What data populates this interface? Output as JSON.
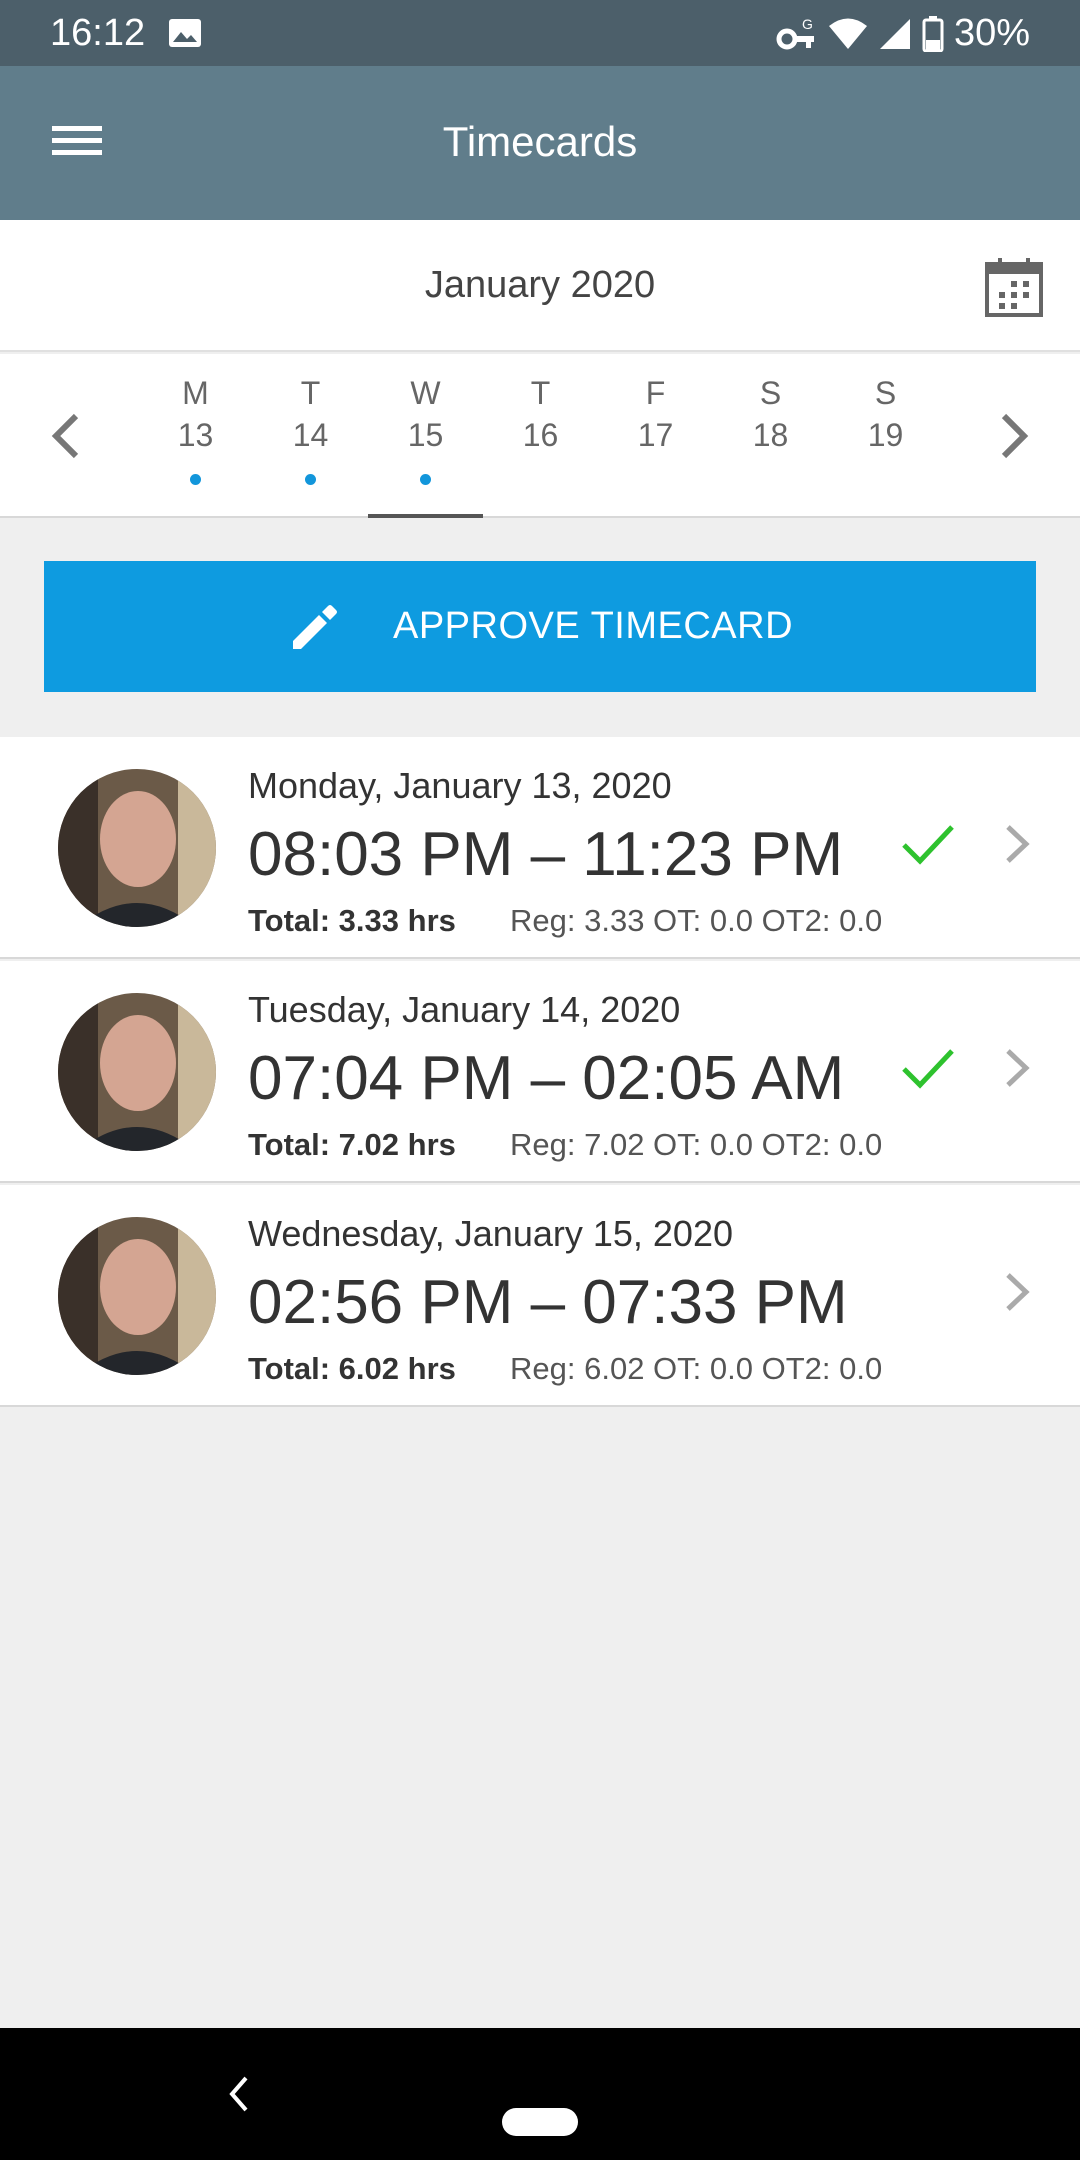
{
  "status_bar": {
    "time": "16:12",
    "battery": "30%"
  },
  "app_bar": {
    "title": "Timecards"
  },
  "month": {
    "label": "January 2020"
  },
  "week": {
    "days": [
      {
        "letter": "M",
        "num": "13",
        "has_entry": true
      },
      {
        "letter": "T",
        "num": "14",
        "has_entry": true
      },
      {
        "letter": "W",
        "num": "15",
        "has_entry": true,
        "selected": true
      },
      {
        "letter": "T",
        "num": "16",
        "has_entry": false
      },
      {
        "letter": "F",
        "num": "17",
        "has_entry": false
      },
      {
        "letter": "S",
        "num": "18",
        "has_entry": false
      },
      {
        "letter": "S",
        "num": "19",
        "has_entry": false
      }
    ]
  },
  "approve_button": {
    "label": "APPROVE TIMECARD"
  },
  "entries": [
    {
      "date": "Monday, January 13, 2020",
      "time_range": "08:03 PM – 11:23 PM",
      "total": "Total: 3.33 hrs",
      "breakdown": "Reg: 3.33 OT: 0.0 OT2: 0.0",
      "approved": true
    },
    {
      "date": "Tuesday, January 14, 2020",
      "time_range": "07:04 PM – 02:05 AM",
      "total": "Total: 7.02 hrs",
      "breakdown": "Reg: 7.02 OT: 0.0 OT2: 0.0",
      "approved": true
    },
    {
      "date": "Wednesday, January 15, 2020",
      "time_range": "02:56 PM – 07:33 PM",
      "total": "Total: 6.02 hrs",
      "breakdown": "Reg: 6.02 OT: 0.0 OT2: 0.0",
      "approved": false
    }
  ],
  "colors": {
    "status_bar": "#4c5f6a",
    "app_bar": "#607d8b",
    "accent": "#0e9be0",
    "check": "#2ec22e",
    "dot": "#1296db"
  }
}
